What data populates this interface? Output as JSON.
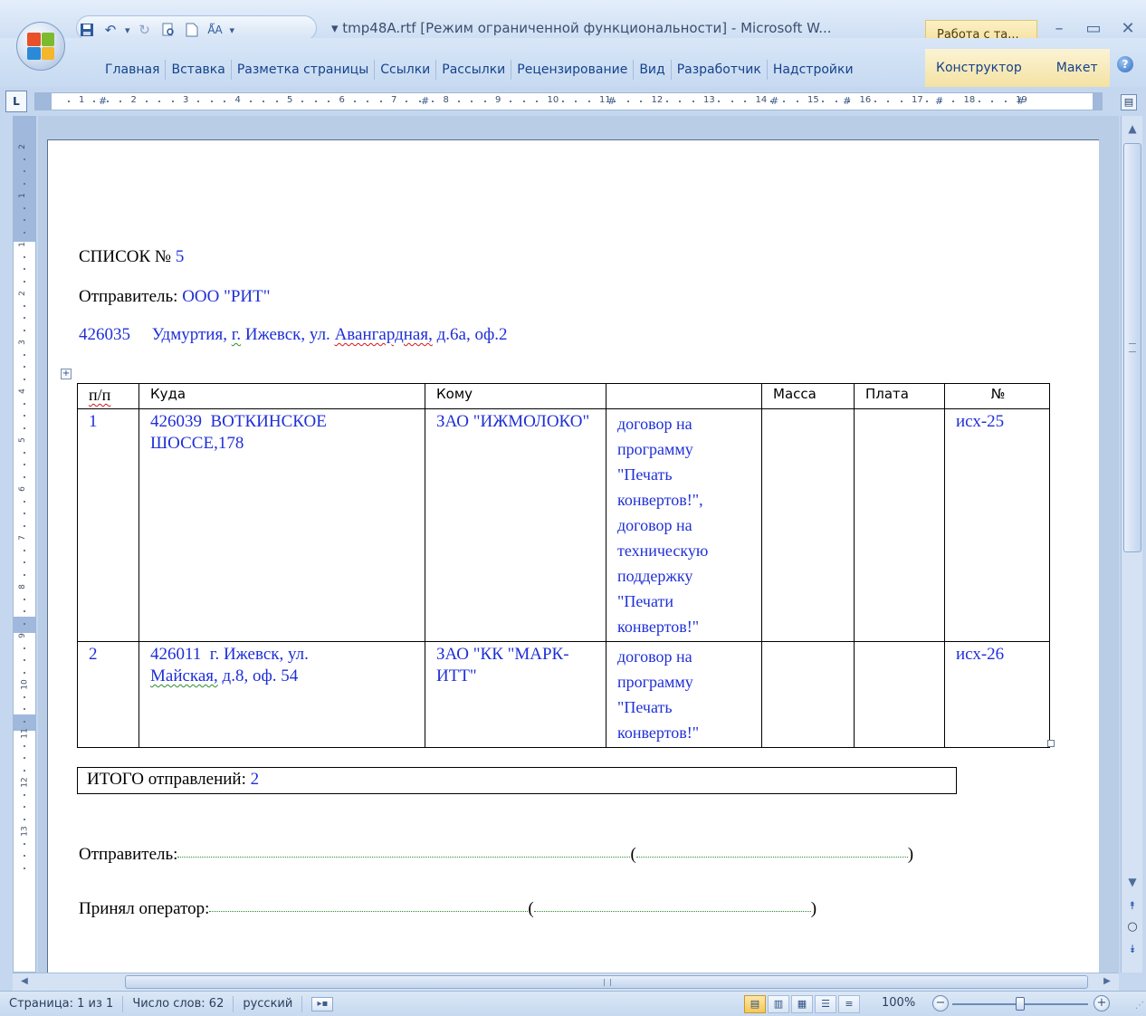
{
  "window": {
    "title": "tmp48A.rtf [Режим ограниченной функциональности] - Microsoft W...",
    "context_group": "Работа с та..."
  },
  "quick_access": {
    "icons": [
      "save-icon",
      "undo-icon",
      "redo-icon",
      "print-preview-icon",
      "new-document-icon",
      "spelling-icon"
    ]
  },
  "ribbon": {
    "tabs": [
      "Главная",
      "Вставка",
      "Разметка страницы",
      "Ссылки",
      "Рассылки",
      "Рецензирование",
      "Вид",
      "Разработчик",
      "Надстройки"
    ],
    "context_tabs": [
      "Конструктор",
      "Макет"
    ]
  },
  "ruler": {
    "toggle_label": "L",
    "h_numbers": [
      "1",
      "2",
      "3",
      "4",
      "5",
      "6",
      "7",
      "8",
      "9",
      "10",
      "11",
      "12",
      "13",
      "14",
      "15",
      "16",
      "17",
      "18",
      "19"
    ],
    "v_numbers": [
      "2",
      "1",
      "1",
      "2",
      "3",
      "4",
      "5",
      "6",
      "7",
      "8",
      "9",
      "10",
      "11",
      "12",
      "13"
    ]
  },
  "document": {
    "heading_prefix": "СПИСОК №",
    "heading_number": "5",
    "sender_label": "Отправитель:",
    "sender_name": "ООО \"РИТ\"",
    "address_zip": "426035",
    "address_pre": "Удмуртия,",
    "address_g": "г.",
    "address_mid": "Ижевск, ул.",
    "address_street": "Авангардная,",
    "address_post": "д.6а, оф.2",
    "table": {
      "headers": [
        "п/п",
        "Куда",
        "Кому",
        "",
        "Масса",
        "Плата",
        "№"
      ],
      "rows": [
        {
          "num": "1",
          "where": "426039  ВОТКИНСКОЕ ШОССЕ,178",
          "to": "ЗАО \"ИЖМОЛОКО\"",
          "desc": "договор на программу \"Печать конвертов!\", договор на техническую поддержку \"Печати конвертов!\"",
          "mass": "",
          "fee": "",
          "ref": "исх-25"
        },
        {
          "num": "2",
          "where_pre": "426011  г. Ижевск, ул.",
          "where_street": "Майская,",
          "where_post": "д.8, оф. 54",
          "to": "ЗАО \"КК \"МАРК-ИТТ\"",
          "desc": "договор на программу \"Печать конвертов!\"",
          "mass": "",
          "fee": "",
          "ref": "исх-26"
        }
      ]
    },
    "total_label": "ИТОГО отправлений:",
    "total_value": "2",
    "sig_sender_label": "Отправитель:",
    "sig_operator_label": "Принял оператор:",
    "paren_open": "(",
    "paren_close": ")"
  },
  "status": {
    "page": "Страница: 1 из 1",
    "words": "Число слов: 62",
    "language": "русский",
    "zoom": "100%",
    "zoom_fraction": 0.5
  }
}
